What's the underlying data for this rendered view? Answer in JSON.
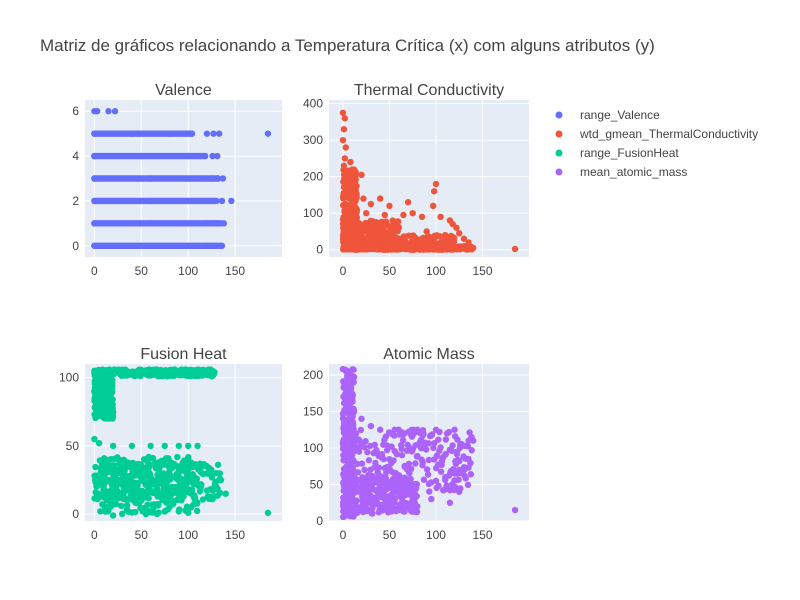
{
  "title": "Matriz de gráficos relacionando a Temperatura Crítica (x) com alguns atributos (y)",
  "colors": {
    "plot_bg": "#E5ECF6",
    "grid": "#ffffff",
    "text": "#444444",
    "valence": "#636EFA",
    "thermal": "#EF553B",
    "fusion": "#00CC96",
    "mass": "#AB63FA"
  },
  "legend": {
    "placement": "top-right",
    "items": [
      {
        "label": "range_Valence",
        "color": "#636EFA"
      },
      {
        "label": "wtd_gmean_ThermalConductivity",
        "color": "#EF553B"
      },
      {
        "label": "range_FusionHeat",
        "color": "#00CC96"
      },
      {
        "label": "mean_atomic_mass",
        "color": "#AB63FA"
      }
    ]
  },
  "chart_data": [
    {
      "type": "scatter",
      "title": "Valence",
      "series_name": "range_Valence",
      "color": "#636EFA",
      "xlim": [
        -10,
        200
      ],
      "ylim": [
        -0.5,
        6.5
      ],
      "xticks": [
        0,
        50,
        100,
        150
      ],
      "yticks": [
        0,
        2,
        4,
        6
      ],
      "grid": true,
      "points": [
        [
          0,
          6
        ],
        [
          3,
          6
        ],
        [
          15,
          6
        ],
        [
          22,
          6
        ],
        [
          0,
          5
        ],
        [
          40,
          5
        ],
        [
          80,
          5
        ],
        [
          104,
          5
        ],
        [
          120,
          5
        ],
        [
          127,
          5
        ],
        [
          133,
          5
        ],
        [
          185,
          5
        ],
        [
          0,
          4
        ],
        [
          50,
          4
        ],
        [
          100,
          4
        ],
        [
          118,
          4
        ],
        [
          126,
          4
        ],
        [
          131,
          4
        ],
        [
          0,
          3
        ],
        [
          60,
          3
        ],
        [
          110,
          3
        ],
        [
          125,
          3
        ],
        [
          132,
          3
        ],
        [
          137,
          3
        ],
        [
          0,
          2
        ],
        [
          60,
          2
        ],
        [
          115,
          2
        ],
        [
          127,
          2
        ],
        [
          136,
          2
        ],
        [
          146,
          2
        ],
        [
          0,
          1
        ],
        [
          60,
          1
        ],
        [
          120,
          1
        ],
        [
          128,
          1
        ],
        [
          138,
          1
        ],
        [
          0,
          0
        ],
        [
          50,
          0
        ],
        [
          100,
          0
        ],
        [
          120,
          0
        ],
        [
          136,
          0
        ]
      ],
      "bands": [
        {
          "y": 5,
          "x": [
            0,
            104
          ]
        },
        {
          "y": 4,
          "x": [
            0,
            118
          ]
        },
        {
          "y": 3,
          "x": [
            0,
            132
          ]
        },
        {
          "y": 2,
          "x": [
            0,
            130
          ]
        },
        {
          "y": 1,
          "x": [
            0,
            135
          ]
        },
        {
          "y": 0,
          "x": [
            0,
            135
          ]
        }
      ]
    },
    {
      "type": "scatter",
      "title": "Thermal Conductivity",
      "series_name": "wtd_gmean_ThermalConductivity",
      "color": "#EF553B",
      "xlim": [
        -15,
        200
      ],
      "ylim": [
        -20,
        410
      ],
      "xticks": [
        0,
        50,
        100,
        150
      ],
      "yticks": [
        0,
        100,
        200,
        300,
        400
      ],
      "grid": true,
      "points": [
        [
          0,
          375
        ],
        [
          2,
          360
        ],
        [
          1,
          330
        ],
        [
          0,
          300
        ],
        [
          3,
          280
        ],
        [
          2,
          250
        ],
        [
          8,
          240
        ],
        [
          1,
          230
        ],
        [
          4,
          210
        ],
        [
          20,
          205
        ],
        [
          9,
          180
        ],
        [
          6,
          160
        ],
        [
          14,
          150
        ],
        [
          22,
          140
        ],
        [
          40,
          140
        ],
        [
          12,
          130
        ],
        [
          30,
          125
        ],
        [
          50,
          120
        ],
        [
          70,
          130
        ],
        [
          5,
          110
        ],
        [
          25,
          100
        ],
        [
          45,
          95
        ],
        [
          65,
          95
        ],
        [
          75,
          100
        ],
        [
          85,
          90
        ],
        [
          97,
          120
        ],
        [
          100,
          180
        ],
        [
          98,
          160
        ],
        [
          105,
          90
        ],
        [
          115,
          80
        ],
        [
          118,
          70
        ],
        [
          122,
          60
        ],
        [
          125,
          45
        ],
        [
          130,
          30
        ],
        [
          135,
          20
        ],
        [
          140,
          5
        ],
        [
          185,
          2
        ],
        [
          60,
          60
        ],
        [
          90,
          50
        ],
        [
          110,
          40
        ],
        [
          20,
          40
        ],
        [
          45,
          30
        ],
        [
          80,
          20
        ],
        [
          100,
          10
        ],
        [
          120,
          8
        ],
        [
          10,
          5
        ],
        [
          30,
          2
        ]
      ],
      "regions": [
        {
          "x": [
            0,
            15
          ],
          "y": [
            0,
            220
          ]
        },
        {
          "x": [
            0,
            60
          ],
          "y": [
            0,
            80
          ]
        },
        {
          "x": [
            0,
            120
          ],
          "y": [
            0,
            40
          ]
        },
        {
          "x": [
            0,
            140
          ],
          "y": [
            0,
            10
          ]
        }
      ]
    },
    {
      "type": "scatter",
      "title": "Fusion Heat",
      "series_name": "range_FusionHeat",
      "color": "#00CC96",
      "xlim": [
        -10,
        200
      ],
      "ylim": [
        -5,
        110
      ],
      "xticks": [
        0,
        50,
        100,
        150
      ],
      "yticks": [
        0,
        50,
        100
      ],
      "grid": true,
      "points": [
        [
          0,
          105
        ],
        [
          50,
          104
        ],
        [
          100,
          104
        ],
        [
          115,
          104
        ],
        [
          128,
          104
        ],
        [
          0,
          90
        ],
        [
          5,
          80
        ],
        [
          10,
          75
        ],
        [
          15,
          70
        ],
        [
          2,
          95
        ],
        [
          0,
          55
        ],
        [
          5,
          52
        ],
        [
          20,
          50
        ],
        [
          40,
          50
        ],
        [
          60,
          50
        ],
        [
          75,
          50
        ],
        [
          90,
          50
        ],
        [
          100,
          50
        ],
        [
          110,
          50
        ],
        [
          10,
          40
        ],
        [
          30,
          38
        ],
        [
          60,
          36
        ],
        [
          90,
          35
        ],
        [
          120,
          35
        ],
        [
          130,
          30
        ],
        [
          135,
          25
        ],
        [
          140,
          15
        ],
        [
          50,
          10
        ],
        [
          80,
          5
        ],
        [
          90,
          2
        ],
        [
          100,
          1
        ],
        [
          185,
          1
        ],
        [
          20,
          -1
        ],
        [
          55,
          0
        ]
      ],
      "regions": [
        {
          "x": [
            0,
            128
          ],
          "y": [
            101,
            106
          ]
        },
        {
          "x": [
            0,
            20
          ],
          "y": [
            70,
            100
          ]
        },
        {
          "x": [
            0,
            110
          ],
          "y": [
            0,
            42
          ]
        },
        {
          "x": [
            0,
            135
          ],
          "y": [
            10,
            38
          ]
        }
      ]
    },
    {
      "type": "scatter",
      "title": "Atomic Mass",
      "series_name": "mean_atomic_mass",
      "color": "#AB63FA",
      "xlim": [
        -15,
        200
      ],
      "ylim": [
        0,
        215
      ],
      "xticks": [
        0,
        50,
        100,
        150
      ],
      "yticks": [
        0,
        50,
        100,
        150,
        200
      ],
      "grid": true,
      "points": [
        [
          0,
          208
        ],
        [
          5,
          205
        ],
        [
          8,
          195
        ],
        [
          3,
          180
        ],
        [
          10,
          170
        ],
        [
          6,
          160
        ],
        [
          12,
          150
        ],
        [
          20,
          140
        ],
        [
          30,
          130
        ],
        [
          40,
          125
        ],
        [
          60,
          125
        ],
        [
          80,
          125
        ],
        [
          100,
          125
        ],
        [
          120,
          125
        ],
        [
          140,
          110
        ],
        [
          135,
          85
        ],
        [
          130,
          70
        ],
        [
          120,
          65
        ],
        [
          110,
          60
        ],
        [
          100,
          55
        ],
        [
          125,
          40
        ],
        [
          95,
          30
        ],
        [
          185,
          15
        ],
        [
          50,
          20
        ],
        [
          30,
          25
        ],
        [
          10,
          10
        ],
        [
          60,
          15
        ],
        [
          80,
          20
        ],
        [
          115,
          25
        ]
      ],
      "regions": [
        {
          "x": [
            0,
            12
          ],
          "y": [
            5,
            210
          ]
        },
        {
          "x": [
            0,
            140
          ],
          "y": [
            40,
            125
          ]
        },
        {
          "x": [
            0,
            80
          ],
          "y": [
            10,
            60
          ]
        }
      ]
    }
  ]
}
